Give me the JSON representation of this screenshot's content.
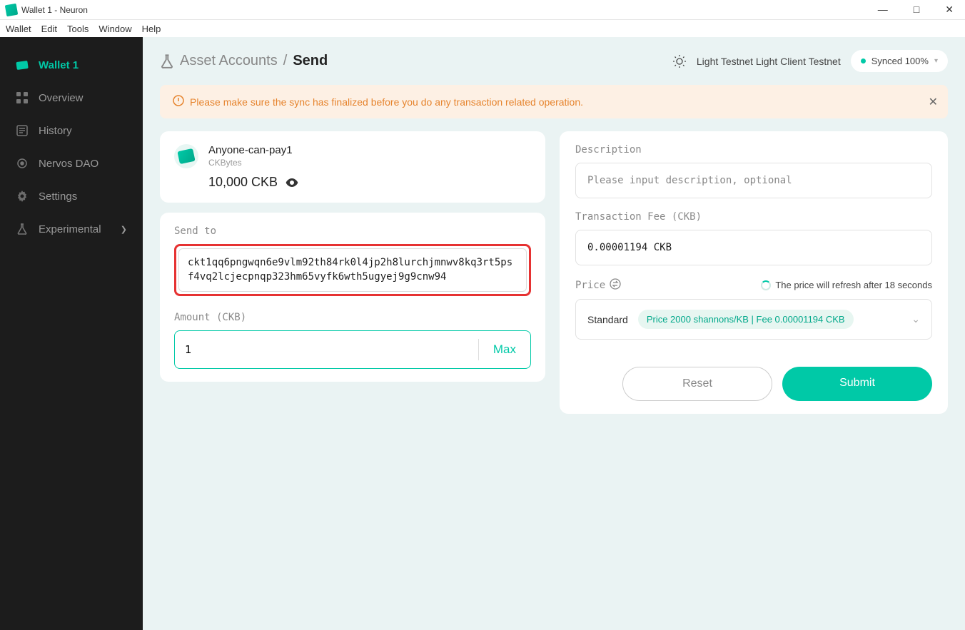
{
  "window": {
    "title": "Wallet 1 - Neuron"
  },
  "menubar": [
    "Wallet",
    "Edit",
    "Tools",
    "Window",
    "Help"
  ],
  "sidebar": {
    "items": [
      {
        "label": "Wallet 1",
        "icon": "wallet-icon",
        "active": true
      },
      {
        "label": "Overview",
        "icon": "grid-icon"
      },
      {
        "label": "History",
        "icon": "history-icon"
      },
      {
        "label": "Nervos DAO",
        "icon": "dao-icon"
      },
      {
        "label": "Settings",
        "icon": "gear-icon"
      },
      {
        "label": "Experimental",
        "icon": "flask-icon",
        "chevron": true
      }
    ]
  },
  "breadcrumb": {
    "parent": "Asset Accounts",
    "sep": "/",
    "current": "Send"
  },
  "network": {
    "label": "Light Testnet Light Client Testnet"
  },
  "sync": {
    "status": "Synced 100%"
  },
  "banner": {
    "text": "Please make sure the sync has finalized before you do any transaction related operation."
  },
  "account": {
    "name": "Anyone-can-pay1",
    "token": "CKBytes",
    "balance": "10,000 CKB"
  },
  "send": {
    "send_to_label": "Send to",
    "address": "ckt1qq6pngwqn6e9vlm92th84rk0l4jp2h8lurchjmnwv8kq3rt5psf4vq2lcjecpnqp323hm65vyfk6wth5ugyej9g9cnw94",
    "amount_label": "Amount (CKB)",
    "amount_value": "1",
    "max_label": "Max"
  },
  "desc": {
    "label": "Description",
    "placeholder": "Please input description, optional"
  },
  "fee": {
    "label": "Transaction Fee (CKB)",
    "value": "0.00001194 CKB"
  },
  "price": {
    "label": "Price",
    "refresh_text": "The price will refresh after 18 seconds",
    "selected": "Standard",
    "detail": "Price 2000 shannons/KB | Fee 0.00001194 CKB"
  },
  "footer": {
    "reset": "Reset",
    "submit": "Submit"
  }
}
